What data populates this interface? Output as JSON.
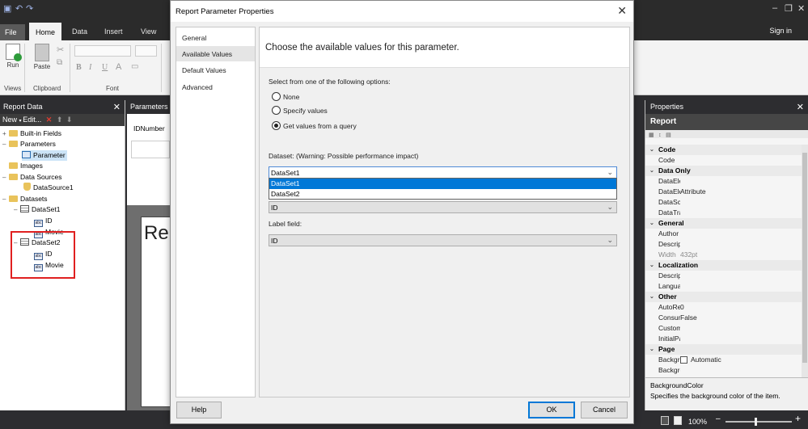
{
  "window": {
    "minimize": "–",
    "maximize": "❐",
    "close": "✕"
  },
  "ribbon": {
    "tabs": [
      "File",
      "Home",
      "Data",
      "Insert",
      "View"
    ],
    "signin": "Sign in",
    "run_label": "Run",
    "views_label": "Views",
    "paste_label": "Paste",
    "clipboard_label": "Clipboard",
    "font_label": "Font",
    "bold": "B",
    "italic": "I",
    "underline": "U"
  },
  "report_data": {
    "title": "Report Data",
    "toolbar": {
      "new": "New",
      "edit": "Edit..."
    },
    "tree": [
      {
        "label": "Built-in Fields",
        "icon": "folder-icon",
        "expander": "+"
      },
      {
        "label": "Parameters",
        "icon": "folder-icon",
        "expander": "–"
      },
      {
        "label": "Parameter",
        "icon": "parameter-icon",
        "expander": ""
      },
      {
        "label": "Images",
        "icon": "folder-icon",
        "expander": ""
      },
      {
        "label": "Data Sources",
        "icon": "folder-icon",
        "expander": "–"
      },
      {
        "label": "DataSource1",
        "icon": "datasource-icon",
        "expander": ""
      },
      {
        "label": "Datasets",
        "icon": "folder-icon",
        "expander": "–"
      },
      {
        "label": "DataSet1",
        "icon": "dataset-icon",
        "expander": "–"
      },
      {
        "label": "ID",
        "icon": "field-icon",
        "expander": ""
      },
      {
        "label": "Movie",
        "icon": "field-icon",
        "expander": ""
      },
      {
        "label": "DataSet2",
        "icon": "dataset-icon",
        "expander": "–"
      },
      {
        "label": "ID",
        "icon": "field-icon",
        "expander": ""
      },
      {
        "label": "Movie",
        "icon": "field-icon",
        "expander": ""
      }
    ]
  },
  "parameters_panel": {
    "title": "Parameters",
    "param": "IDNumber"
  },
  "design": {
    "title_fragment": "Re"
  },
  "dialog": {
    "title": "Report Parameter Properties",
    "nav": [
      "General",
      "Available Values",
      "Default Values",
      "Advanced"
    ],
    "header": "Choose the available values for this parameter.",
    "options_label": "Select from one of the following options:",
    "options": [
      "None",
      "Specify values",
      "Get values from a query"
    ],
    "dataset_label": "Dataset: (Warning: Possible performance impact)",
    "dataset_value": "DataSet1",
    "dropdown_options": [
      "DataSet1",
      "DataSet2"
    ],
    "value_field_value": "ID",
    "label_field_label": "Label field:",
    "label_field_value": "ID",
    "help": "Help",
    "ok": "OK",
    "cancel": "Cancel"
  },
  "properties": {
    "title": "Properties",
    "object": "Report",
    "rows": [
      {
        "type": "cat",
        "name": "Code"
      },
      {
        "type": "prop",
        "name": "Code",
        "value": ""
      },
      {
        "type": "cat",
        "name": "Data Only"
      },
      {
        "type": "prop",
        "name": "DataElementName",
        "value": ""
      },
      {
        "type": "prop",
        "name": "DataElementStyle",
        "value": "Attribute"
      },
      {
        "type": "prop",
        "name": "DataSchema",
        "value": ""
      },
      {
        "type": "prop",
        "name": "DataTransform",
        "value": ""
      },
      {
        "type": "cat",
        "name": "General"
      },
      {
        "type": "prop",
        "name": "Author",
        "value": ""
      },
      {
        "type": "prop",
        "name": "Description",
        "value": ""
      },
      {
        "type": "prop",
        "name": "Width",
        "value": "432pt"
      },
      {
        "type": "cat",
        "name": "Localization"
      },
      {
        "type": "prop",
        "name": "Description",
        "value": ""
      },
      {
        "type": "prop",
        "name": "Language",
        "value": ""
      },
      {
        "type": "cat",
        "name": "Other"
      },
      {
        "type": "prop",
        "name": "AutoRefresh",
        "value": "0"
      },
      {
        "type": "prop",
        "name": "ConsumeContainerWhitespace",
        "value": "False"
      },
      {
        "type": "prop",
        "name": "CustomProperties",
        "value": ""
      },
      {
        "type": "prop",
        "name": "InitialPageName",
        "value": ""
      },
      {
        "type": "cat",
        "name": "Page"
      },
      {
        "type": "prop",
        "name": "BackgroundColor",
        "value": "Automatic"
      },
      {
        "type": "prop",
        "name": "BackgroundImage",
        "value": ""
      }
    ],
    "desc_title": "BackgroundColor",
    "desc_text": "Specifies the background color of the item."
  },
  "status": {
    "zoom": "100%"
  },
  "colors": {
    "accent": "#0078d7",
    "highlight_box": "#e02020",
    "dark": "#2d2d30"
  }
}
